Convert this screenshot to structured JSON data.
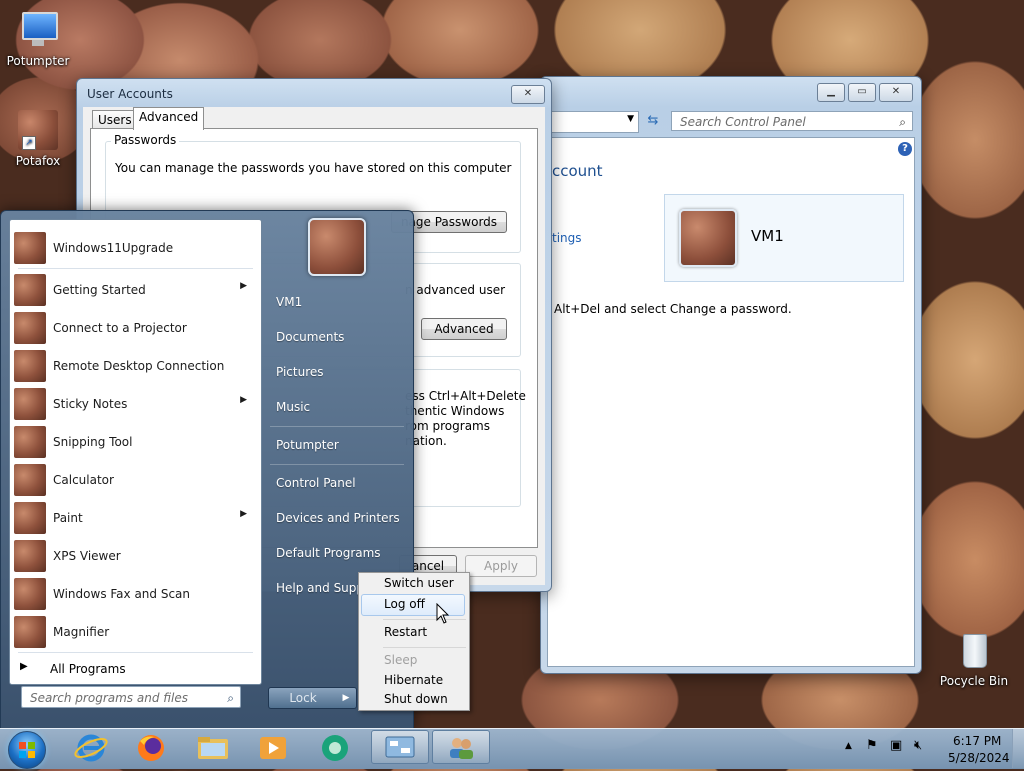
{
  "desktop": {
    "icons": [
      {
        "label": "Potumpter",
        "icon": "computer-icon"
      },
      {
        "label": "Potafox",
        "icon": "potato-shortcut-icon"
      },
      {
        "label": "Pocycle Bin",
        "icon": "recycle-bin-icon"
      }
    ]
  },
  "control_panel": {
    "search_placeholder": "Search Control Panel",
    "heading": "ccount",
    "link": "tings",
    "user_name": "VM1",
    "note": "Alt+Del and select Change a password."
  },
  "user_accounts": {
    "title": "User Accounts",
    "tabs": [
      "Users",
      "Advanced"
    ],
    "passwords_group": "Passwords",
    "passwords_text": "You can manage the passwords you have stored on this computer",
    "manage_btn": "nage Passwords",
    "advanced_text": "n advanced user",
    "advanced_btn": "Advanced",
    "secure_text": [
      "ess Ctrl+Alt+Delete",
      "thentic Windows",
      "rom programs",
      "nation."
    ],
    "cancel_btn": "ancel",
    "apply_btn": "Apply"
  },
  "start_menu": {
    "programs": [
      {
        "label": "Windows11Upgrade",
        "submenu": false
      },
      {
        "label": "Getting Started",
        "submenu": true
      },
      {
        "label": "Connect to a Projector",
        "submenu": false
      },
      {
        "label": "Remote Desktop Connection",
        "submenu": false
      },
      {
        "label": "Sticky Notes",
        "submenu": true
      },
      {
        "label": "Snipping Tool",
        "submenu": false
      },
      {
        "label": "Calculator",
        "submenu": false
      },
      {
        "label": "Paint",
        "submenu": true
      },
      {
        "label": "XPS Viewer",
        "submenu": false
      },
      {
        "label": "Windows Fax and Scan",
        "submenu": false
      },
      {
        "label": "Magnifier",
        "submenu": false
      }
    ],
    "all_programs": "All Programs",
    "search_placeholder": "Search programs and files",
    "right_items": [
      "VM1",
      "Documents",
      "Pictures",
      "Music",
      "Potumpter",
      "Control Panel",
      "Devices and Printers",
      "Default Programs",
      "Help and Suppo"
    ],
    "lock": "Lock"
  },
  "power_menu": {
    "items": [
      {
        "label": "Switch user",
        "disabled": false
      },
      {
        "label": "Log off",
        "disabled": false
      },
      {
        "label": "Restart",
        "disabled": false
      },
      {
        "label": "Sleep",
        "disabled": true
      },
      {
        "label": "Hibernate",
        "disabled": false
      },
      {
        "label": "Shut down",
        "disabled": false
      }
    ]
  },
  "taskbar": {
    "time": "6:17 PM",
    "date": "5/28/2024"
  }
}
